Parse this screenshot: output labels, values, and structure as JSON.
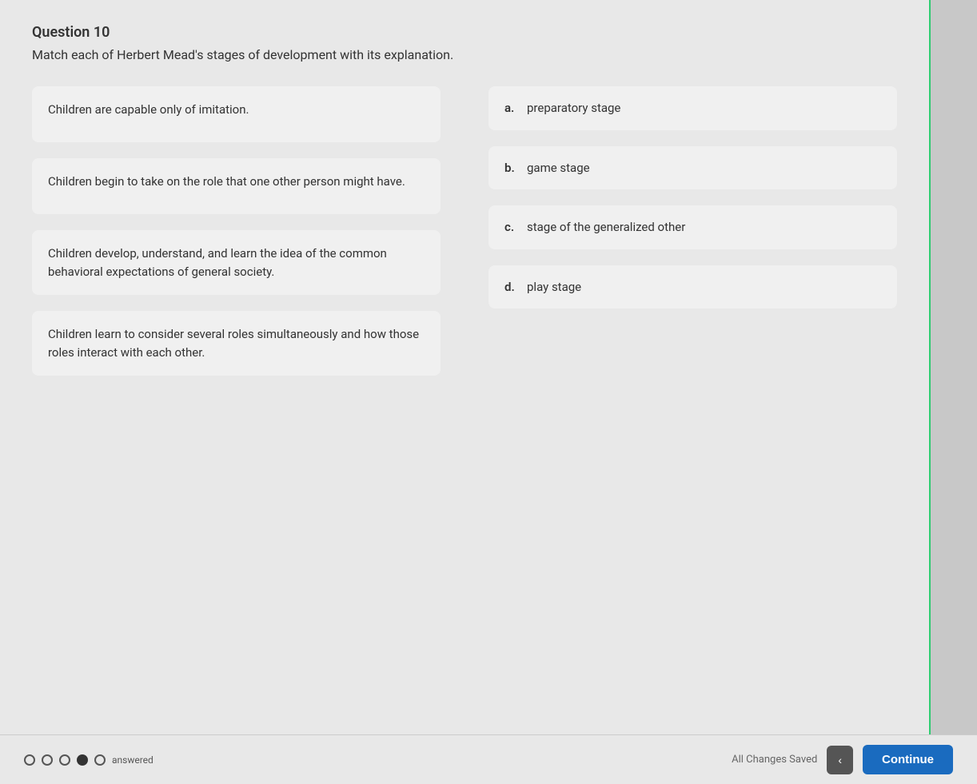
{
  "question": {
    "number": "Question 10",
    "instruction": "Match each of Herbert Mead's stages of development with its explanation.",
    "left_items": [
      {
        "id": "item-1",
        "text": "Children are capable only of imitation."
      },
      {
        "id": "item-2",
        "text": "Children begin to take on the role that one other person might have."
      },
      {
        "id": "item-3",
        "text": "Children develop, understand, and learn the idea of the common behavioral expectations of general society."
      },
      {
        "id": "item-4",
        "text": "Children learn to consider several roles simultaneously and how those roles interact with each other."
      }
    ],
    "right_options": [
      {
        "id": "option-a",
        "letter": "a.",
        "text": "preparatory stage"
      },
      {
        "id": "option-b",
        "letter": "b.",
        "text": "game stage"
      },
      {
        "id": "option-c",
        "letter": "c.",
        "text": "stage of the generalized other"
      },
      {
        "id": "option-d",
        "letter": "d.",
        "text": "play stage"
      }
    ]
  },
  "bottom_bar": {
    "status": "All Changes Saved",
    "continue_label": "Continue",
    "prev_label": "‹",
    "answered_label": "answered"
  },
  "progress": {
    "dots": [
      "outlined",
      "outlined",
      "outlined",
      "filled",
      "outlined"
    ]
  }
}
